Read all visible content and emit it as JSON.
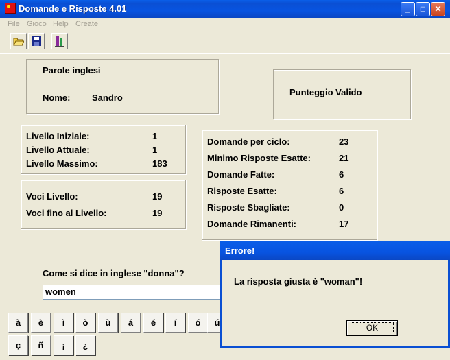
{
  "window": {
    "title": "Domande e Risposte 4.01",
    "minimize": "_",
    "maximize": "□",
    "close": "✕"
  },
  "menu": [
    "File",
    "Gioco",
    "Help",
    "Create"
  ],
  "toolbar": {
    "icons": [
      "open-folder-icon",
      "save-disk-icon",
      "book-icon"
    ]
  },
  "info": {
    "category": "Parole inglesi",
    "name_label": "Nome:",
    "name_value": "Sandro"
  },
  "score_status": "Punteggio Valido",
  "levels": [
    {
      "label": "Livello Iniziale:",
      "value": "1"
    },
    {
      "label": "Livello Attuale:",
      "value": "1"
    },
    {
      "label": "Livello Massimo:",
      "value": "183"
    }
  ],
  "entries": [
    {
      "label": "Voci Livello:",
      "value": "19"
    },
    {
      "label": "Voci fino al Livello:",
      "value": "19"
    }
  ],
  "stats": [
    {
      "label": "Domande per ciclo:",
      "value": "23"
    },
    {
      "label": "Minimo Risposte Esatte:",
      "value": "21"
    },
    {
      "label": "Domande Fatte:",
      "value": "6"
    },
    {
      "label": "Risposte Esatte:",
      "value": "6"
    },
    {
      "label": "Risposte Sbagliate:",
      "value": "0"
    },
    {
      "label": "Domande Rimanenti:",
      "value": "17"
    }
  ],
  "question": "Come si dice in inglese \"donna\"?",
  "answer_value": "women",
  "keys_row1": [
    "à",
    "è",
    "ì",
    "ò",
    "ù",
    "á",
    "é",
    "í",
    "ó",
    "ú"
  ],
  "keys_row2": [
    "ç",
    "ñ",
    "¡",
    "¿"
  ],
  "dialog": {
    "title": "Errore!",
    "message": "La risposta giusta è \"woman\"!",
    "ok_label": "OK"
  },
  "colors": {
    "titlebar": "#0a4fd3",
    "background": "#ece9d8"
  }
}
